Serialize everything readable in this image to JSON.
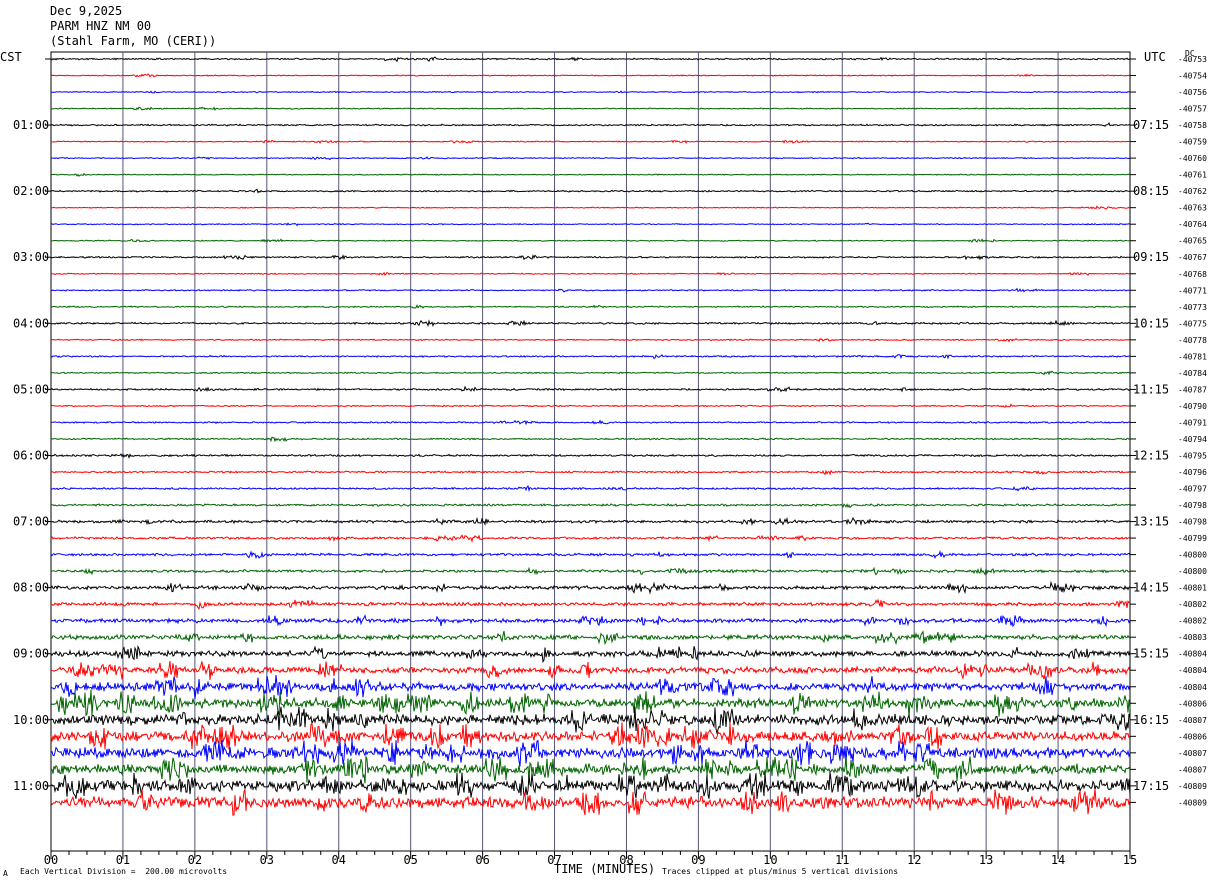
{
  "header": {
    "date": "Dec 9,2025",
    "station": "PARM HNZ NM 00",
    "location": "(Stahl Farm, MO (CERI))"
  },
  "left_zone": "CST",
  "right_zone": "UTC",
  "dc_label": "DC",
  "footer": {
    "scale_mark": "A",
    "scale_text": "Each Vertical Division =  200.00 microvolts",
    "clip_text": "Traces clipped at plus/minus 5 vertical divisions"
  },
  "colors": {
    "trace_cycle": [
      "#000000",
      "#ff0000",
      "#0000ff",
      "#006400"
    ],
    "grid": "#555577"
  },
  "chart_data": {
    "type": "line",
    "xlabel": "TIME (MINUTES)",
    "x_ticks": [
      "00",
      "01",
      "02",
      "03",
      "04",
      "05",
      "06",
      "07",
      "08",
      "09",
      "10",
      "11",
      "12",
      "13",
      "14",
      "15"
    ],
    "xlim": [
      0,
      15
    ],
    "left_time_labels": [
      "01:00",
      "02:00",
      "03:00",
      "04:00",
      "05:00",
      "06:00",
      "07:00",
      "08:00",
      "09:00",
      "10:00",
      "11:00"
    ],
    "right_time_labels": [
      "07:15",
      "08:15",
      "09:15",
      "10:15",
      "11:15",
      "12:15",
      "13:15",
      "14:15",
      "15:15",
      "16:15",
      "17:15"
    ],
    "dc_offsets": [
      "-40753",
      "-40754",
      "-40756",
      "-40757",
      "-40758",
      "-40759",
      "-40760",
      "-40761",
      "-40762",
      "-40763",
      "-40764",
      "-40765",
      "-40767",
      "-40768",
      "-40771",
      "-40773",
      "-40775",
      "-40778",
      "-40781",
      "-40784",
      "-40787",
      "-40790",
      "-40791",
      "-40794",
      "-40795",
      "-40796",
      "-40797",
      "-40798",
      "-40798",
      "-40799",
      "-40800",
      "-40800",
      "-40801",
      "-40802",
      "-40802",
      "-40803",
      "-40804",
      "-40804",
      "-40804",
      "-40806",
      "-40807",
      "-40806",
      "-40807",
      "-40807",
      "-40809",
      "-40809"
    ],
    "trace_activity": [
      0.6,
      0.4,
      0.4,
      0.4,
      0.6,
      0.4,
      0.4,
      0.4,
      0.6,
      0.4,
      0.4,
      0.4,
      0.6,
      0.4,
      0.5,
      0.5,
      0.7,
      0.5,
      0.6,
      0.5,
      0.7,
      0.5,
      0.6,
      0.6,
      0.8,
      0.7,
      0.7,
      0.8,
      1.0,
      0.9,
      1.0,
      1.0,
      1.4,
      1.3,
      1.6,
      1.8,
      2.2,
      2.6,
      3.2,
      3.6,
      4.2,
      4.0,
      4.2,
      4.0,
      4.6,
      4.4
    ]
  }
}
